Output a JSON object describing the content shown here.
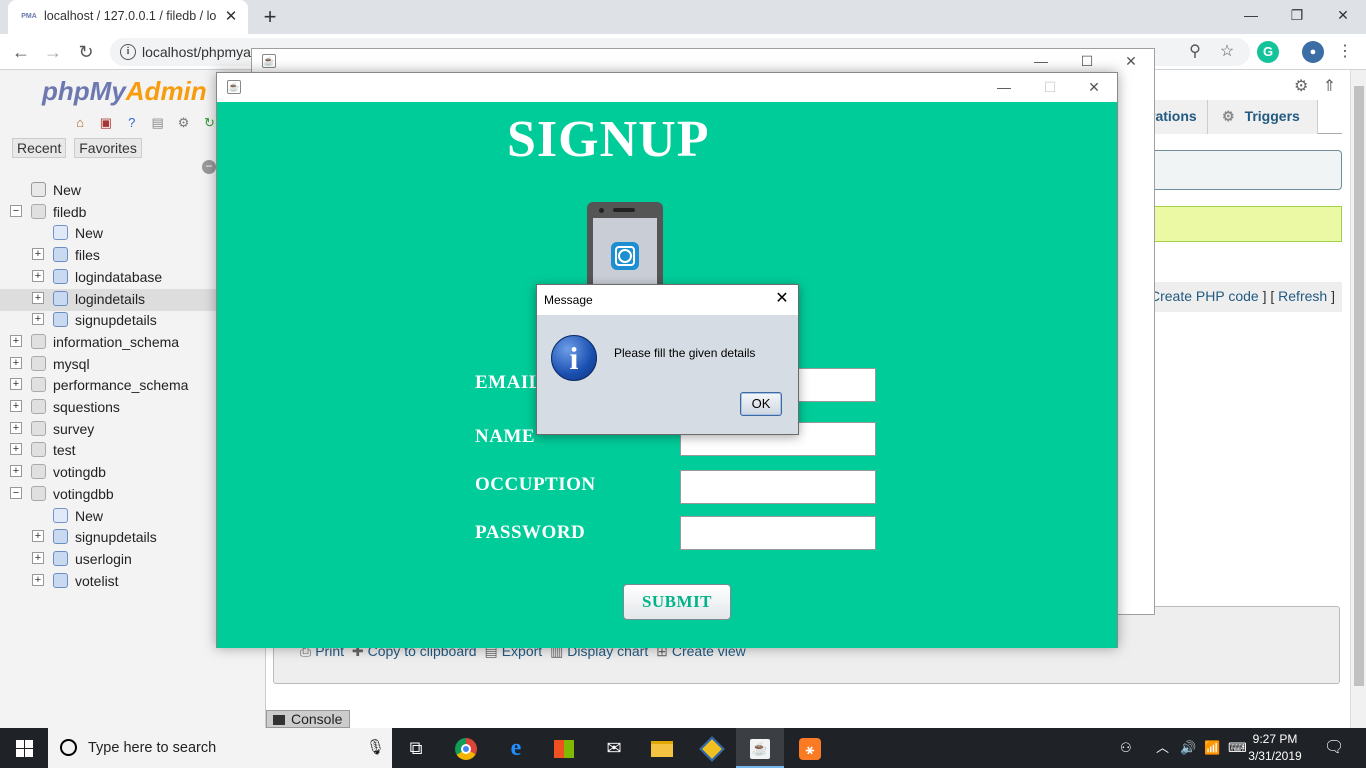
{
  "browser": {
    "tab_title": "localhost / 127.0.0.1 / filedb / lo",
    "tab_favicon": "PMA",
    "url": "localhost/phpmya",
    "controls": {
      "minimize": "—",
      "restore": "❐",
      "close": "✕"
    }
  },
  "pma": {
    "logo_php": "php",
    "logo_my": "My",
    "logo_admin": "Admin",
    "nav_tabs": [
      "Recent",
      "Favorites"
    ],
    "tree": [
      {
        "label": "New",
        "type": "new",
        "indent": 0
      },
      {
        "label": "filedb",
        "type": "db",
        "indent": 0,
        "expanded": true
      },
      {
        "label": "New",
        "type": "new",
        "indent": 1
      },
      {
        "label": "files",
        "type": "table",
        "indent": 1
      },
      {
        "label": "logindatabase",
        "type": "table",
        "indent": 1
      },
      {
        "label": "logindetails",
        "type": "table",
        "indent": 1,
        "selected": true
      },
      {
        "label": "signupdetails",
        "type": "table",
        "indent": 1
      },
      {
        "label": "information_schema",
        "type": "db",
        "indent": 0
      },
      {
        "label": "mysql",
        "type": "db",
        "indent": 0
      },
      {
        "label": "performance_schema",
        "type": "db",
        "indent": 0
      },
      {
        "label": "squestions",
        "type": "db",
        "indent": 0
      },
      {
        "label": "survey",
        "type": "db",
        "indent": 0
      },
      {
        "label": "test",
        "type": "db",
        "indent": 0
      },
      {
        "label": "votingdb",
        "type": "db",
        "indent": 0
      },
      {
        "label": "votingdbb",
        "type": "db",
        "indent": 0,
        "expanded": true
      },
      {
        "label": "New",
        "type": "new",
        "indent": 1
      },
      {
        "label": "signupdetails",
        "type": "table",
        "indent": 1
      },
      {
        "label": "userlogin",
        "type": "table",
        "indent": 1
      },
      {
        "label": "votelist",
        "type": "table",
        "indent": 1
      }
    ],
    "main_tabs": [
      "rations",
      "Triggers"
    ],
    "link_bar": {
      "create_php": "Create PHP code",
      "sep": " ] [ ",
      "refresh": "Refresh",
      "end": " ]"
    },
    "ops": [
      "Print",
      "Copy to clipboard",
      "Export",
      "Display chart",
      "Create view"
    ],
    "console_label": "Console"
  },
  "signup": {
    "title": "SIGNUP",
    "fields": [
      {
        "label": "EMAIL",
        "value": ""
      },
      {
        "label": "NAME",
        "value": ""
      },
      {
        "label": "OCCUPTION",
        "value": ""
      },
      {
        "label": "PASSWORD",
        "value": ""
      }
    ],
    "submit_label": "SUBMIT"
  },
  "dialog": {
    "title": "Message",
    "message": "Please fill the given details",
    "ok_label": "OK",
    "icon": "information-icon"
  },
  "taskbar": {
    "search_placeholder": "Type here to search",
    "time": "9:27 PM",
    "date": "3/31/2019",
    "active_app": "java"
  },
  "colors": {
    "signup_bg": "#00cc99",
    "pma_blue": "#6c78af",
    "pma_orange": "#f89c0e",
    "link": "#235a81",
    "taskbar": "#1f2327"
  }
}
